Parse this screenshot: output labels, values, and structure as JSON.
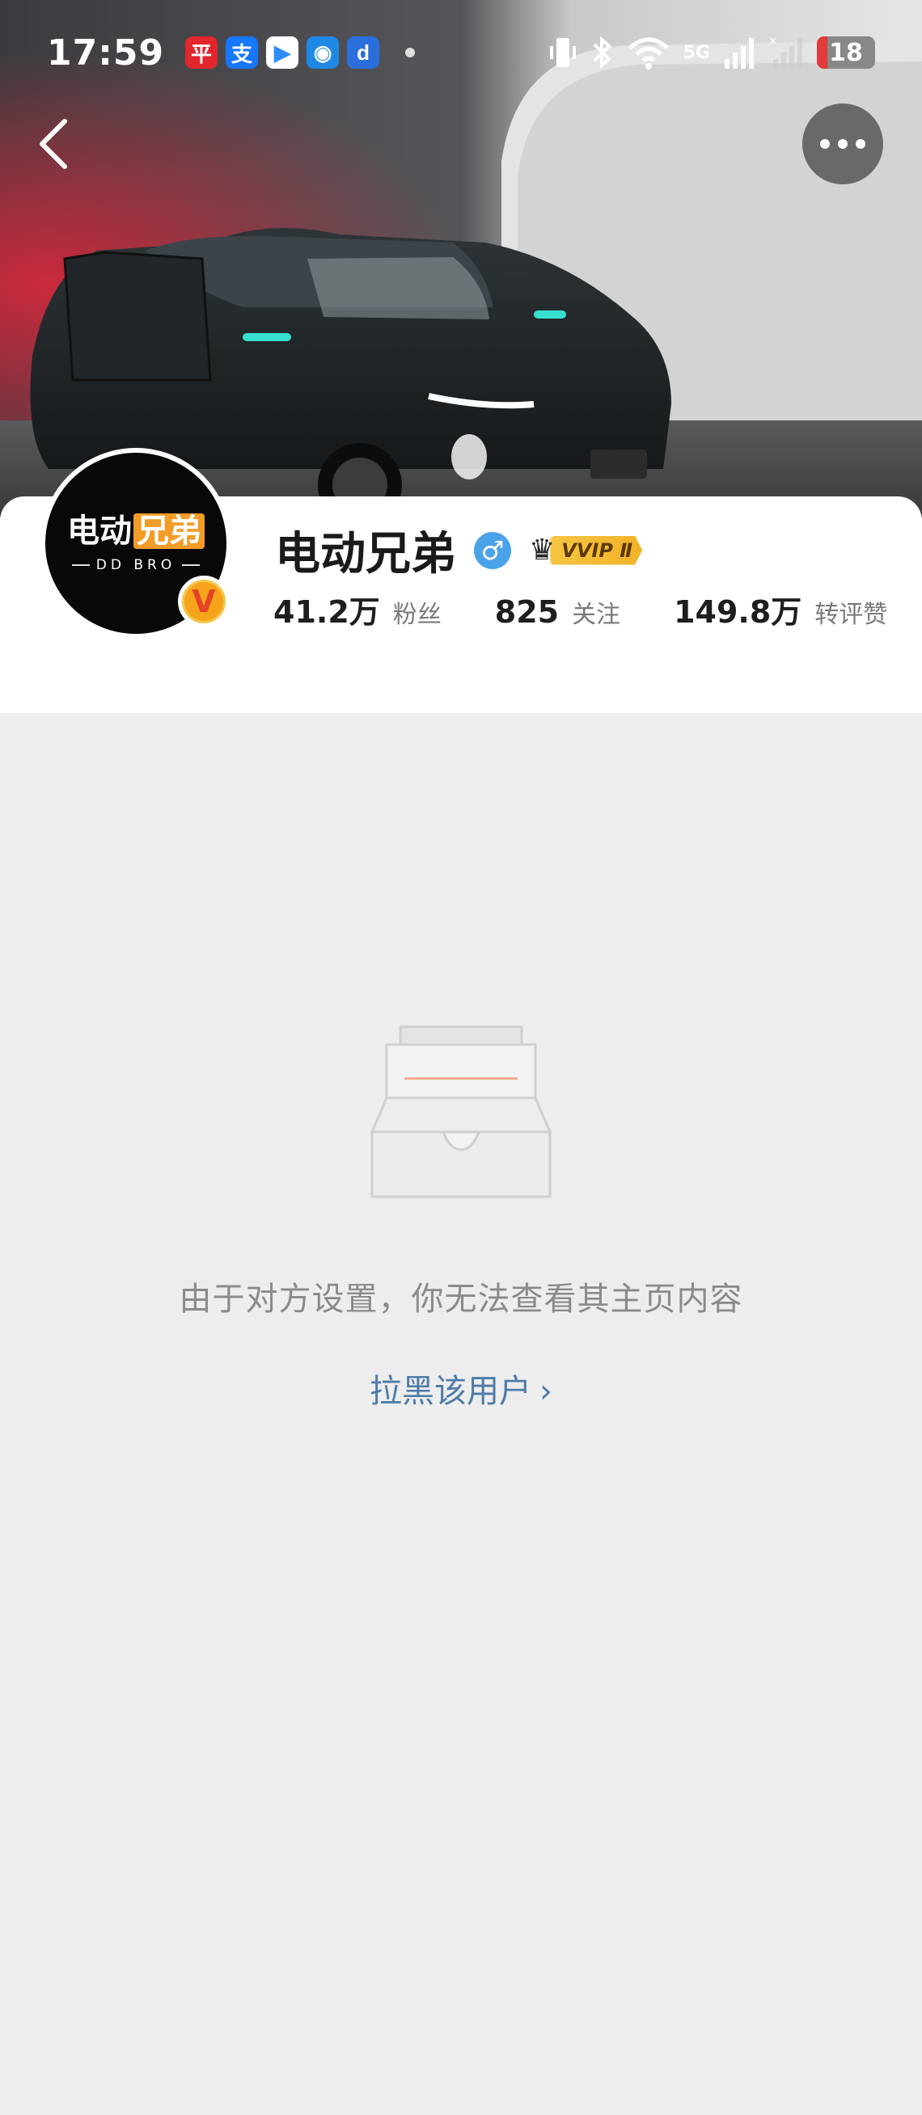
{
  "status_bar": {
    "time": "17:59",
    "notification_apps": [
      {
        "name": "app-icon-1",
        "glyph": "平",
        "color": "#e1262d"
      },
      {
        "name": "alipay-icon",
        "glyph": "支",
        "color": "#1677ff"
      },
      {
        "name": "video-app-icon",
        "glyph": "▶",
        "color": "#2e8cff"
      },
      {
        "name": "qq-icon",
        "glyph": "◉",
        "color": "#1e88e5"
      },
      {
        "name": "app-icon-5",
        "glyph": "d",
        "color": "#2a6fdb"
      }
    ],
    "network": "5G",
    "battery": "18",
    "battery_percent": 18
  },
  "profile": {
    "name": "电动兄弟",
    "gender_symbol": "♂",
    "vip_label": "VVIP Ⅱ",
    "avatar_logo_main": "电动",
    "avatar_logo_highlight": "兄弟",
    "avatar_logo_sub": "DD BRO",
    "verified_mark": "V",
    "stats": [
      {
        "value": "41.2万",
        "label": "粉丝"
      },
      {
        "value": "825",
        "label": "关注"
      },
      {
        "value": "149.8万",
        "label": "转评赞"
      }
    ]
  },
  "content": {
    "empty_message": "由于对方设置，你无法查看其主页内容",
    "block_link": "拉黑该用户",
    "block_chevron": "›"
  },
  "colors": {
    "accent_link": "#4e7ba8",
    "vip_gold": "#f2b227",
    "verified_orange": "#f7a41b"
  }
}
